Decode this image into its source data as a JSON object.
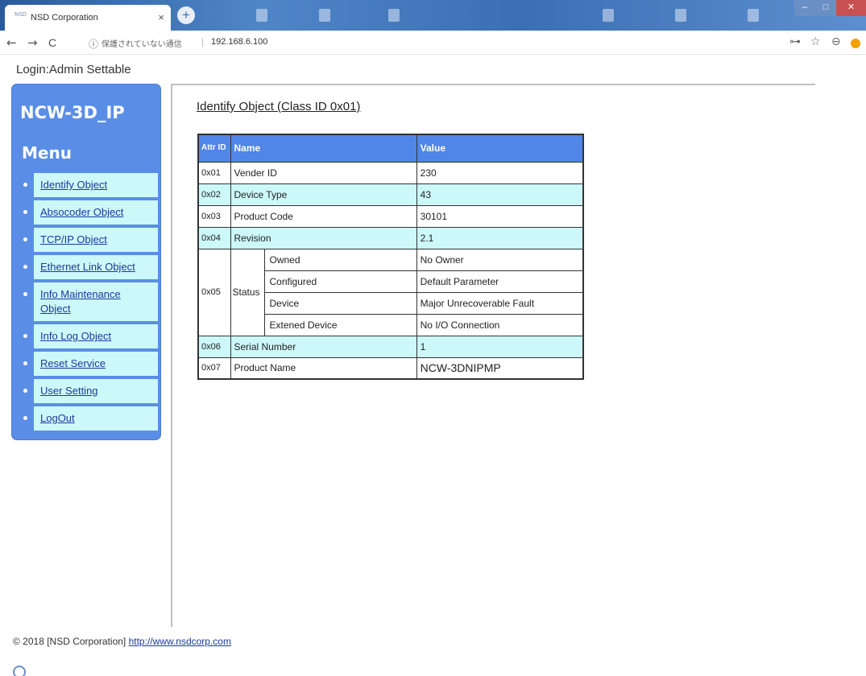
{
  "browser": {
    "tab_favicon_text": "NSD",
    "tab_title": "NSD Corporation",
    "tab_close": "×",
    "new_tab": "+",
    "nav": {
      "back": "←",
      "forward": "→",
      "reload": "C"
    },
    "address": {
      "info_icon": "ⓘ",
      "security_text": "保護されていない通信",
      "separator": "|",
      "url": "192.168.6.100"
    },
    "tools": {
      "key_icon": "⊶",
      "star_icon": "☆",
      "account_icon": "⊖"
    }
  },
  "page": {
    "login": "Login:Admin Settable",
    "sidebar": {
      "device": "NCW-3D_IP",
      "menu_title": "Menu",
      "items": [
        {
          "label": "Identify Object"
        },
        {
          "label": "Absocoder Object"
        },
        {
          "label": "TCP/IP Object"
        },
        {
          "label": "Ethernet Link Object"
        },
        {
          "label": "Info Maintenance Object"
        },
        {
          "label": "Info Log Object"
        },
        {
          "label": "Reset Service"
        },
        {
          "label": "User Setting"
        },
        {
          "label": "LogOut"
        }
      ]
    },
    "content_title": "Identify Object (Class ID 0x01)",
    "table": {
      "headers": {
        "id": "Attr ID",
        "name": "Name",
        "value": "Value"
      },
      "rows": [
        {
          "id": "0x01",
          "name": "Vender ID",
          "value": "230"
        },
        {
          "id": "0x02",
          "name": "Device Type",
          "value": "43"
        },
        {
          "id": "0x03",
          "name": "Product Code",
          "value": "30101"
        },
        {
          "id": "0x04",
          "name": "Revision",
          "value": "2.1"
        }
      ],
      "status": {
        "id": "0x05",
        "name": "Status",
        "sub": [
          {
            "name": "Owned",
            "value": "No Owner"
          },
          {
            "name": "Configured",
            "value": "Default Parameter"
          },
          {
            "name": "Device",
            "value": "Major Unrecoverable Fault"
          },
          {
            "name": "Extened Device",
            "value": "No I/O Connection"
          }
        ]
      },
      "rows_after": [
        {
          "id": "0x06",
          "name": "Serial Number",
          "value": "1"
        },
        {
          "id": "0x07",
          "name": "Product Name",
          "value": "NCW-3DNIPMP"
        }
      ]
    },
    "footer": {
      "text": "© 2018 [NSD Corporation]",
      "link": "http://www.nsdcorp.com"
    }
  },
  "colors": {
    "sidebar_bg": "#5a8ee6",
    "menu_box_bg": "#ccf8fa",
    "table_header_bg": "#4f86e8",
    "row_alt_bg": "#ccf8fa",
    "link": "#1a3a9c"
  }
}
